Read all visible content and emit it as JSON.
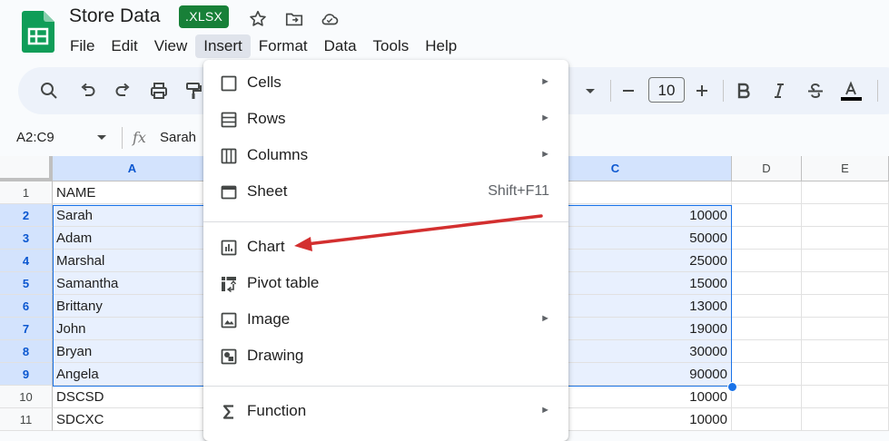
{
  "doc": {
    "title": "Store Data",
    "format_badge": ".XLSX"
  },
  "menus": [
    "File",
    "Edit",
    "View",
    "Insert",
    "Format",
    "Data",
    "Tools",
    "Help"
  ],
  "active_menu_index": 3,
  "toolbar": {
    "font_size": "10"
  },
  "formula_bar": {
    "name_box": "A2:C9",
    "fx_label": "fx",
    "value": "Sarah"
  },
  "columns": [
    "A",
    "C",
    "D",
    "E"
  ],
  "rows": [
    {
      "num": "1",
      "a": "NAME",
      "c": ""
    },
    {
      "num": "2",
      "a": "Sarah",
      "c": "10000"
    },
    {
      "num": "3",
      "a": "Adam",
      "c": "50000"
    },
    {
      "num": "4",
      "a": "Marshal",
      "c": "25000"
    },
    {
      "num": "5",
      "a": "Samantha",
      "c": "15000"
    },
    {
      "num": "6",
      "a": "Brittany",
      "c": "13000"
    },
    {
      "num": "7",
      "a": "John",
      "c": "19000"
    },
    {
      "num": "8",
      "a": "Bryan",
      "c": "30000"
    },
    {
      "num": "9",
      "a": "Angela",
      "c": "90000"
    },
    {
      "num": "10",
      "a": "DSCSD",
      "c": "10000"
    },
    {
      "num": "11",
      "a": "SDCXC",
      "c": "10000"
    }
  ],
  "insert_menu": [
    {
      "label": "Cells",
      "icon": "cells-icon",
      "submenu": true,
      "shortcut": ""
    },
    {
      "label": "Rows",
      "icon": "rows-icon",
      "submenu": true,
      "shortcut": ""
    },
    {
      "label": "Columns",
      "icon": "columns-icon",
      "submenu": true,
      "shortcut": ""
    },
    {
      "label": "Sheet",
      "icon": "sheet-icon",
      "submenu": false,
      "shortcut": "Shift+F11"
    },
    {
      "label": "Chart",
      "icon": "chart-icon",
      "submenu": false,
      "shortcut": ""
    },
    {
      "label": "Pivot table",
      "icon": "pivot-table-icon",
      "submenu": false,
      "shortcut": ""
    },
    {
      "label": "Image",
      "icon": "image-icon",
      "submenu": true,
      "shortcut": ""
    },
    {
      "label": "Drawing",
      "icon": "drawing-icon",
      "submenu": false,
      "shortcut": ""
    },
    {
      "label": "Function",
      "icon": "function-icon",
      "submenu": true,
      "shortcut": ""
    }
  ],
  "submenu_arrow": "►",
  "colors": {
    "brand_green": "#188038",
    "selection": "#e8f0fe",
    "selection_border": "#1a73e8",
    "annotation_arrow": "#d32f2f"
  }
}
